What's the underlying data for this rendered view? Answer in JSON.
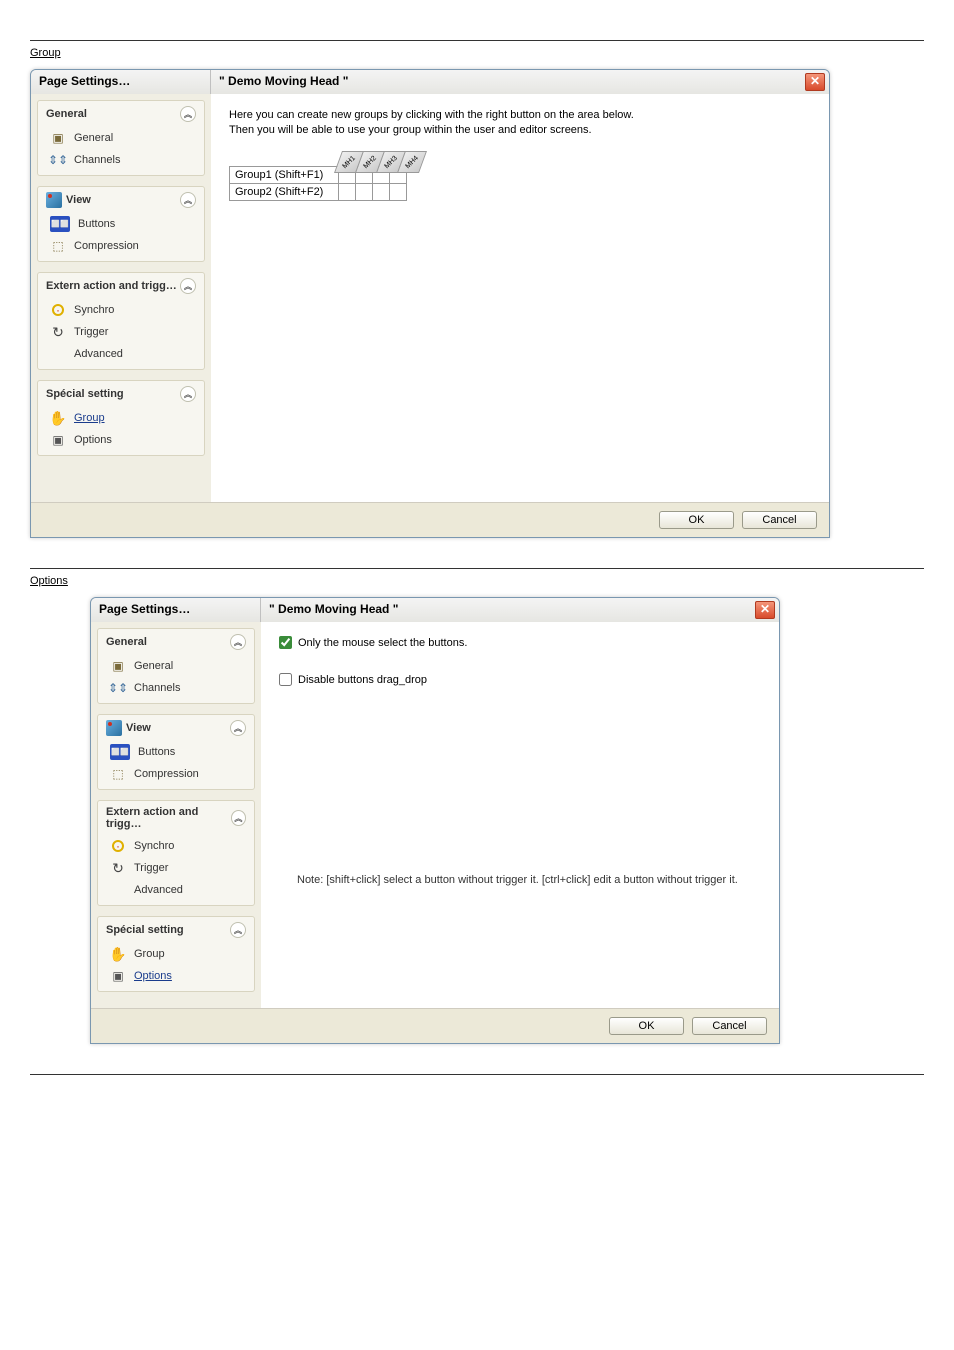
{
  "section1": {
    "label": "Group"
  },
  "section2": {
    "label": "Options"
  },
  "dialog1": {
    "titleLeft": "Page  Settings…",
    "titleCenter": "\" Demo Moving Head \"",
    "description": "Here you can create new groups by clicking with the right button on the area below.\nThen you will be able to use your group within the user and editor screens.",
    "fixtures": [
      "MH1",
      "MH2",
      "MH3",
      "MH4"
    ],
    "groups": [
      {
        "label": "Group1 (Shift+F1)"
      },
      {
        "label": "Group2 (Shift+F2)"
      }
    ],
    "ok": "OK",
    "cancel": "Cancel"
  },
  "dialog2": {
    "titleLeft": "Page  Settings…",
    "titleCenter": "\" Demo Moving Head \"",
    "cb1": "Only the mouse select the buttons.",
    "cb2": "Disable buttons drag_drop",
    "note": "Note: [shift+click] select a button without trigger it.  [ctrl+click] edit a button without trigger it.",
    "ok": "OK",
    "cancel": "Cancel"
  },
  "sidebar": {
    "g1": {
      "title": "General",
      "i1": "General",
      "i2": "Channels"
    },
    "g2": {
      "title": "View",
      "i1": "Buttons",
      "i2": "Compression"
    },
    "g3": {
      "title": "Extern action and trigg…",
      "i1": "Synchro",
      "i2": "Trigger",
      "i3": "Advanced"
    },
    "g4": {
      "title": "Spécial setting",
      "i1": "Group",
      "i2": "Options"
    }
  }
}
